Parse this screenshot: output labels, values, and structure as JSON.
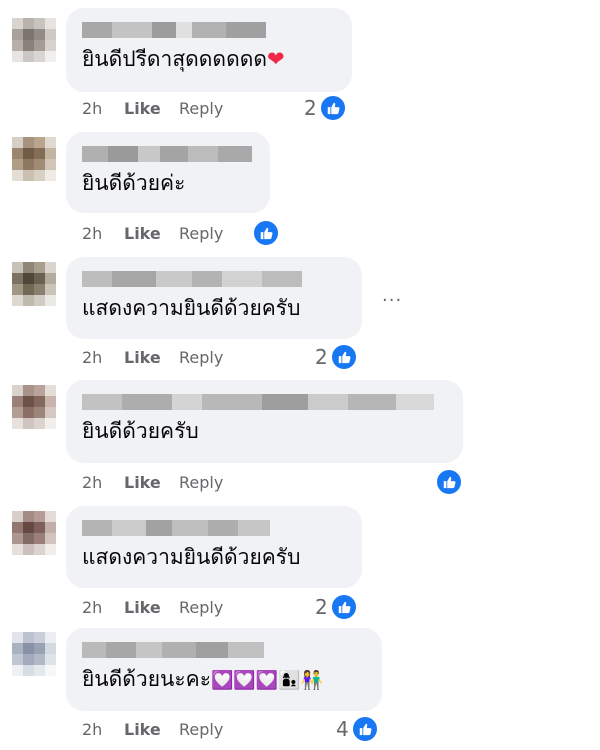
{
  "comments": [
    {
      "text": "ยินดีปรีดาสุดดดดดด",
      "time": "2h",
      "like": "Like",
      "reply": "Reply",
      "reactions": "2"
    },
    {
      "text": "ยินดีด้วยค่ะ",
      "time": "2h",
      "like": "Like",
      "reply": "Reply",
      "reactions": ""
    },
    {
      "text": "แสดงความยินดีด้วยครับ",
      "time": "2h",
      "like": "Like",
      "reply": "Reply",
      "reactions": "2"
    },
    {
      "text": "ยินดีด้วยครับ",
      "time": "2h",
      "like": "Like",
      "reply": "Reply",
      "reactions": ""
    },
    {
      "text": "แสดงความยินดีด้วยครับ",
      "time": "2h",
      "like": "Like",
      "reply": "Reply",
      "reactions": "2"
    },
    {
      "text": "ยินดีด้วยนะคะ",
      "time": "2h",
      "like": "Like",
      "reply": "Reply",
      "reactions": "4"
    }
  ],
  "more_menu": "···",
  "icons": {
    "heart": "❤",
    "pink_hearts": "💟💟💟",
    "people": "👩‍👦👫"
  },
  "colors": {
    "bubble": "#f0f2f5",
    "meta": "#65676b",
    "like_blue": "#1877f2",
    "heart": "#f02849"
  }
}
